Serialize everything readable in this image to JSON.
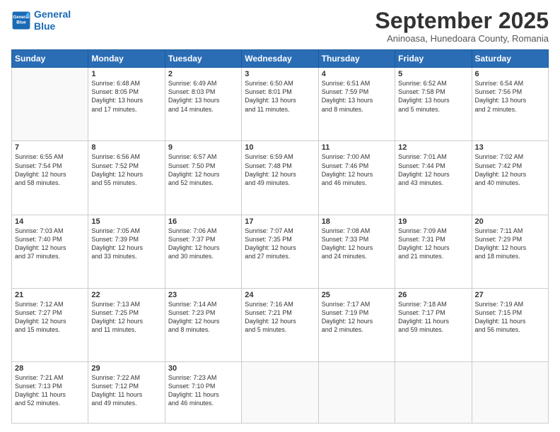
{
  "logo": {
    "line1": "General",
    "line2": "Blue"
  },
  "title": "September 2025",
  "subtitle": "Aninoasa, Hunedoara County, Romania",
  "weekdays": [
    "Sunday",
    "Monday",
    "Tuesday",
    "Wednesday",
    "Thursday",
    "Friday",
    "Saturday"
  ],
  "weeks": [
    [
      {
        "day": "",
        "info": ""
      },
      {
        "day": "1",
        "info": "Sunrise: 6:48 AM\nSunset: 8:05 PM\nDaylight: 13 hours\nand 17 minutes."
      },
      {
        "day": "2",
        "info": "Sunrise: 6:49 AM\nSunset: 8:03 PM\nDaylight: 13 hours\nand 14 minutes."
      },
      {
        "day": "3",
        "info": "Sunrise: 6:50 AM\nSunset: 8:01 PM\nDaylight: 13 hours\nand 11 minutes."
      },
      {
        "day": "4",
        "info": "Sunrise: 6:51 AM\nSunset: 7:59 PM\nDaylight: 13 hours\nand 8 minutes."
      },
      {
        "day": "5",
        "info": "Sunrise: 6:52 AM\nSunset: 7:58 PM\nDaylight: 13 hours\nand 5 minutes."
      },
      {
        "day": "6",
        "info": "Sunrise: 6:54 AM\nSunset: 7:56 PM\nDaylight: 13 hours\nand 2 minutes."
      }
    ],
    [
      {
        "day": "7",
        "info": "Sunrise: 6:55 AM\nSunset: 7:54 PM\nDaylight: 12 hours\nand 58 minutes."
      },
      {
        "day": "8",
        "info": "Sunrise: 6:56 AM\nSunset: 7:52 PM\nDaylight: 12 hours\nand 55 minutes."
      },
      {
        "day": "9",
        "info": "Sunrise: 6:57 AM\nSunset: 7:50 PM\nDaylight: 12 hours\nand 52 minutes."
      },
      {
        "day": "10",
        "info": "Sunrise: 6:59 AM\nSunset: 7:48 PM\nDaylight: 12 hours\nand 49 minutes."
      },
      {
        "day": "11",
        "info": "Sunrise: 7:00 AM\nSunset: 7:46 PM\nDaylight: 12 hours\nand 46 minutes."
      },
      {
        "day": "12",
        "info": "Sunrise: 7:01 AM\nSunset: 7:44 PM\nDaylight: 12 hours\nand 43 minutes."
      },
      {
        "day": "13",
        "info": "Sunrise: 7:02 AM\nSunset: 7:42 PM\nDaylight: 12 hours\nand 40 minutes."
      }
    ],
    [
      {
        "day": "14",
        "info": "Sunrise: 7:03 AM\nSunset: 7:40 PM\nDaylight: 12 hours\nand 37 minutes."
      },
      {
        "day": "15",
        "info": "Sunrise: 7:05 AM\nSunset: 7:39 PM\nDaylight: 12 hours\nand 33 minutes."
      },
      {
        "day": "16",
        "info": "Sunrise: 7:06 AM\nSunset: 7:37 PM\nDaylight: 12 hours\nand 30 minutes."
      },
      {
        "day": "17",
        "info": "Sunrise: 7:07 AM\nSunset: 7:35 PM\nDaylight: 12 hours\nand 27 minutes."
      },
      {
        "day": "18",
        "info": "Sunrise: 7:08 AM\nSunset: 7:33 PM\nDaylight: 12 hours\nand 24 minutes."
      },
      {
        "day": "19",
        "info": "Sunrise: 7:09 AM\nSunset: 7:31 PM\nDaylight: 12 hours\nand 21 minutes."
      },
      {
        "day": "20",
        "info": "Sunrise: 7:11 AM\nSunset: 7:29 PM\nDaylight: 12 hours\nand 18 minutes."
      }
    ],
    [
      {
        "day": "21",
        "info": "Sunrise: 7:12 AM\nSunset: 7:27 PM\nDaylight: 12 hours\nand 15 minutes."
      },
      {
        "day": "22",
        "info": "Sunrise: 7:13 AM\nSunset: 7:25 PM\nDaylight: 12 hours\nand 11 minutes."
      },
      {
        "day": "23",
        "info": "Sunrise: 7:14 AM\nSunset: 7:23 PM\nDaylight: 12 hours\nand 8 minutes."
      },
      {
        "day": "24",
        "info": "Sunrise: 7:16 AM\nSunset: 7:21 PM\nDaylight: 12 hours\nand 5 minutes."
      },
      {
        "day": "25",
        "info": "Sunrise: 7:17 AM\nSunset: 7:19 PM\nDaylight: 12 hours\nand 2 minutes."
      },
      {
        "day": "26",
        "info": "Sunrise: 7:18 AM\nSunset: 7:17 PM\nDaylight: 11 hours\nand 59 minutes."
      },
      {
        "day": "27",
        "info": "Sunrise: 7:19 AM\nSunset: 7:15 PM\nDaylight: 11 hours\nand 56 minutes."
      }
    ],
    [
      {
        "day": "28",
        "info": "Sunrise: 7:21 AM\nSunset: 7:13 PM\nDaylight: 11 hours\nand 52 minutes."
      },
      {
        "day": "29",
        "info": "Sunrise: 7:22 AM\nSunset: 7:12 PM\nDaylight: 11 hours\nand 49 minutes."
      },
      {
        "day": "30",
        "info": "Sunrise: 7:23 AM\nSunset: 7:10 PM\nDaylight: 11 hours\nand 46 minutes."
      },
      {
        "day": "",
        "info": ""
      },
      {
        "day": "",
        "info": ""
      },
      {
        "day": "",
        "info": ""
      },
      {
        "day": "",
        "info": ""
      }
    ]
  ]
}
